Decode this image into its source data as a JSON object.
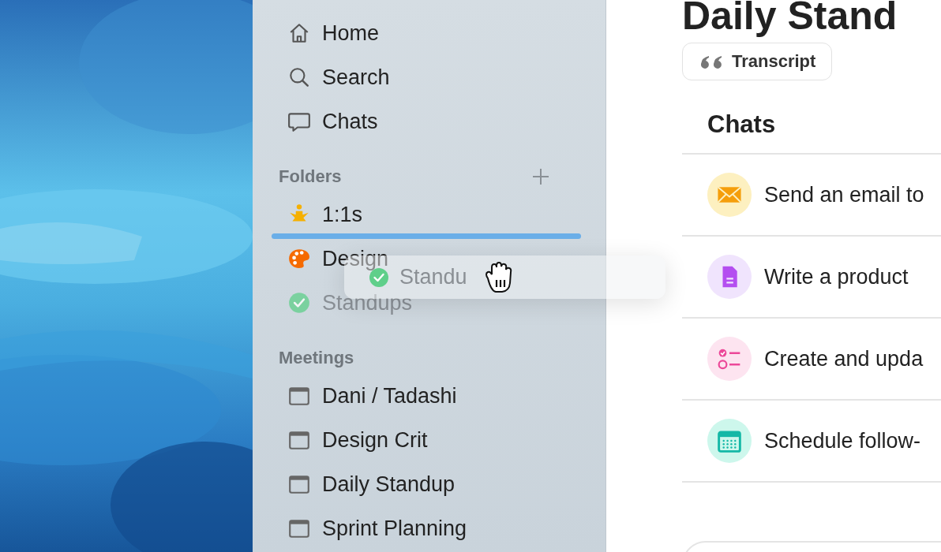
{
  "sidebar": {
    "nav": [
      {
        "label": "Home",
        "kind": "home"
      },
      {
        "label": "Search",
        "kind": "search"
      },
      {
        "label": "Chats",
        "kind": "chat"
      }
    ],
    "sections": [
      {
        "title": "Folders",
        "has_add": true,
        "items": [
          {
            "label": "1:1s",
            "kind": "meditate",
            "dimmed": false,
            "drop_target": true
          },
          {
            "label": "Design",
            "kind": "palette",
            "dimmed": false,
            "drop_target": false
          },
          {
            "label": "Standups",
            "kind": "check",
            "dimmed": true,
            "drop_target": false
          }
        ]
      },
      {
        "title": "Meetings",
        "has_add": false,
        "items": [
          {
            "label": "Dani / Tadashi",
            "kind": "window",
            "dimmed": false,
            "drop_target": false
          },
          {
            "label": "Design Crit",
            "kind": "window",
            "dimmed": false,
            "drop_target": false
          },
          {
            "label": "Daily Standup",
            "kind": "window",
            "dimmed": false,
            "drop_target": false
          },
          {
            "label": "Sprint Planning",
            "kind": "window",
            "dimmed": false,
            "drop_target": false
          }
        ]
      }
    ]
  },
  "drag_ghost": {
    "label": "Standu",
    "kind": "check"
  },
  "main": {
    "title": "Daily Stand",
    "transcript_button": "Transcript",
    "chats_heading": "Chats",
    "chats": [
      {
        "text": "Send an email to",
        "kind": "mail",
        "color": "#f59e0b"
      },
      {
        "text": "Write a product",
        "kind": "document",
        "color": "#b44ef0"
      },
      {
        "text": "Create and upda",
        "kind": "checklist",
        "color": "#ec4899"
      },
      {
        "text": "Schedule follow-",
        "kind": "calendar",
        "color": "#14b8a6"
      }
    ]
  }
}
